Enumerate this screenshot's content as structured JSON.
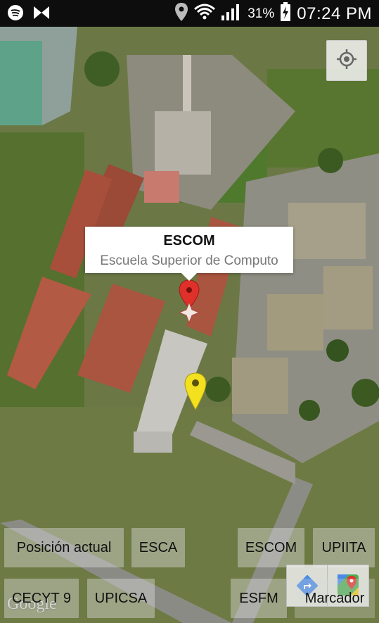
{
  "status_bar": {
    "icons_left": [
      "spotify-icon",
      "app-icon"
    ],
    "icons_right": [
      "location-icon",
      "wifi-icon",
      "signal-icon"
    ],
    "battery_percent": "31%",
    "battery_icon": "battery-charging-icon",
    "time": "07:24 PM"
  },
  "map": {
    "my_location_icon": "crosshair-icon",
    "info_window": {
      "title": "ESCOM",
      "snippet": "Escuela Superior de Computo"
    },
    "markers": [
      {
        "name": "red-marker",
        "color": "#e0302a"
      },
      {
        "name": "yellow-marker",
        "color": "#f3e01f"
      }
    ],
    "logo_text": "Google",
    "toolbar_icons": [
      "directions-icon",
      "google-maps-icon"
    ]
  },
  "buttons": {
    "posicion_actual": "Posición actual",
    "esca": "ESCA",
    "escom": "ESCOM",
    "upiita": "UPIITA",
    "cecyt9": "CECYT 9",
    "upicsa": "UPICSA",
    "esfm": "ESFM",
    "marcador": "Marcador"
  }
}
